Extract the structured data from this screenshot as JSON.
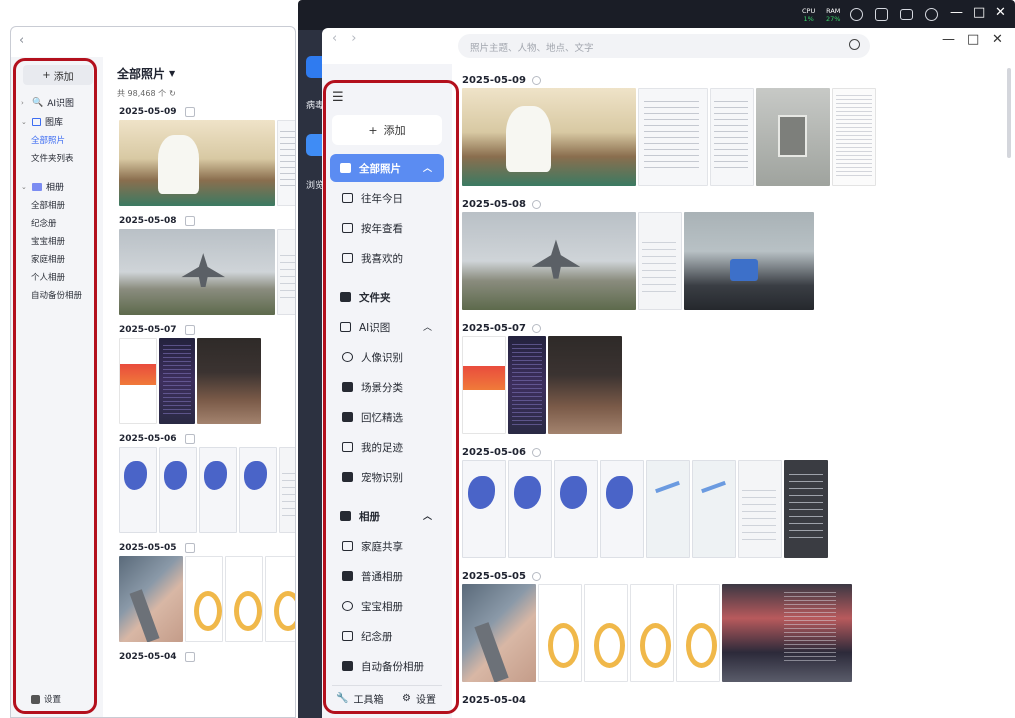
{
  "left_window": {
    "add_label": "添加",
    "sidebar": {
      "ai": "AI识图",
      "gallery": "图库",
      "gallery_items": [
        "全部照片",
        "文件夹列表"
      ],
      "albums": "相册",
      "album_items": [
        "全部相册",
        "纪念册",
        "宝宝相册",
        "家庭相册",
        "个人相册",
        "自动备份相册"
      ],
      "settings": "设置"
    },
    "main": {
      "title": "全部照片",
      "count": "共 98,468 个",
      "dates": [
        "2025-05-09",
        "2025-05-08",
        "2025-05-07",
        "2025-05-06",
        "2025-05-05",
        "2025-05-04"
      ]
    }
  },
  "topbar": {
    "cpu_label": "CPU",
    "cpu_value": "1%",
    "ram_label": "RAM",
    "ram_value": "27%",
    "minimize": "—",
    "maximize": "□",
    "close": "✕"
  },
  "desktop": {
    "icon1_label": "病毒",
    "icon2_label": "浏览"
  },
  "right_window": {
    "nav_back": "‹",
    "nav_forward": "›",
    "search_placeholder": "照片主题、人物、地点、文字",
    "ctrl_minimize": "—",
    "ctrl_maximize": "□",
    "ctrl_close": "✕",
    "sidebar": {
      "add_label": "添加",
      "all_photos": "全部照片",
      "on_this_day": "往年今日",
      "by_year": "按年查看",
      "favorites": "我喜欢的",
      "folders": "文件夹",
      "ai": "AI识图",
      "people": "人像识别",
      "scenes": "场景分类",
      "memories": "回忆精选",
      "footprints": "我的足迹",
      "pets": "宠物识别",
      "albums": "相册",
      "family_share": "家庭共享",
      "normal_album": "普通相册",
      "baby_album": "宝宝相册",
      "memorial": "纪念册",
      "auto_backup": "自动备份相册",
      "toolbox": "工具箱",
      "settings": "设置"
    },
    "dates": [
      "2025-05-09",
      "2025-05-08",
      "2025-05-07",
      "2025-05-06",
      "2025-05-05",
      "2025-05-04"
    ]
  },
  "colors": {
    "accent": "#5b8cf2",
    "highlight_frame": "#b3101d",
    "topbar": "#1a1d26"
  }
}
